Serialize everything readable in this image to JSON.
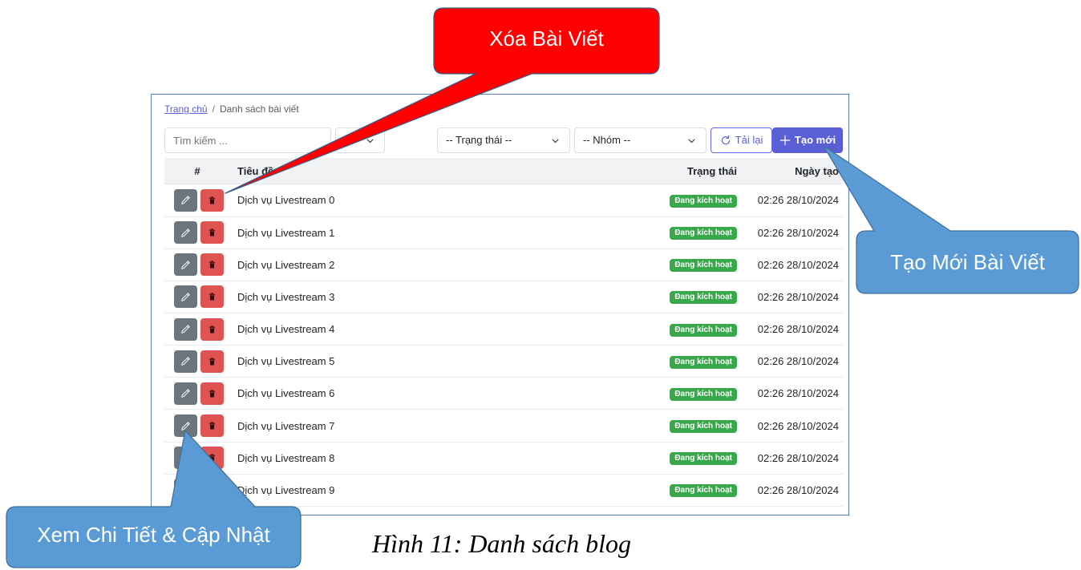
{
  "breadcrumb": {
    "home": "Trang chủ",
    "separator": "/",
    "current": "Danh sách bài viết"
  },
  "filters": {
    "search_placeholder": "Tìm kiếm ...",
    "status": "-- Trạng thái --",
    "group": "-- Nhóm --"
  },
  "actions": {
    "reload": "Tải lại",
    "create": "Tạo mới"
  },
  "table": {
    "headers": {
      "index": "#",
      "title": "Tiêu đề",
      "status": "Trạng thái",
      "created": "Ngày tạo"
    },
    "rows": [
      {
        "title": "Dịch vụ Livestream 0",
        "status": "Đang kích hoạt",
        "created": "02:26 28/10/2024"
      },
      {
        "title": "Dịch vụ Livestream 1",
        "status": "Đang kích hoạt",
        "created": "02:26 28/10/2024"
      },
      {
        "title": "Dịch vụ Livestream 2",
        "status": "Đang kích hoạt",
        "created": "02:26 28/10/2024"
      },
      {
        "title": "Dịch vụ Livestream 3",
        "status": "Đang kích hoạt",
        "created": "02:26 28/10/2024"
      },
      {
        "title": "Dịch vụ Livestream 4",
        "status": "Đang kích hoạt",
        "created": "02:26 28/10/2024"
      },
      {
        "title": "Dịch vụ Livestream 5",
        "status": "Đang kích hoạt",
        "created": "02:26 28/10/2024"
      },
      {
        "title": "Dịch vụ Livestream 6",
        "status": "Đang kích hoạt",
        "created": "02:26 28/10/2024"
      },
      {
        "title": "Dịch vụ Livestream 7",
        "status": "Đang kích hoạt",
        "created": "02:26 28/10/2024"
      },
      {
        "title": "Dịch vụ Livestream 8",
        "status": "Đang kích hoạt",
        "created": "02:26 28/10/2024"
      },
      {
        "title": "Dịch vụ Livestream 9",
        "status": "Đang kích hoạt",
        "created": "02:26 28/10/2024"
      }
    ]
  },
  "callouts": {
    "delete": {
      "label": "Xóa Bài Viết",
      "fill": "#ff0000"
    },
    "create": {
      "label": "Tạo Mới Bài Viết",
      "fill": "#5b9bd5"
    },
    "detail": {
      "label": "Xem Chi Tiết & Cập Nhật",
      "fill": "#5b9bd5"
    }
  },
  "caption": "Hình 11: Danh sách blog",
  "icons": {
    "edit": "pencil-icon",
    "delete": "trash-icon",
    "reload": "refresh-icon",
    "create": "plus-icon",
    "dropdown": "chevron-down-icon"
  },
  "colors": {
    "accent": "#5b5fd6",
    "edit_button": "#6c757d",
    "delete_button": "#e05353",
    "status_active": "#38a84a",
    "callout_red": "#ff0000",
    "callout_blue": "#5b9bd5"
  }
}
